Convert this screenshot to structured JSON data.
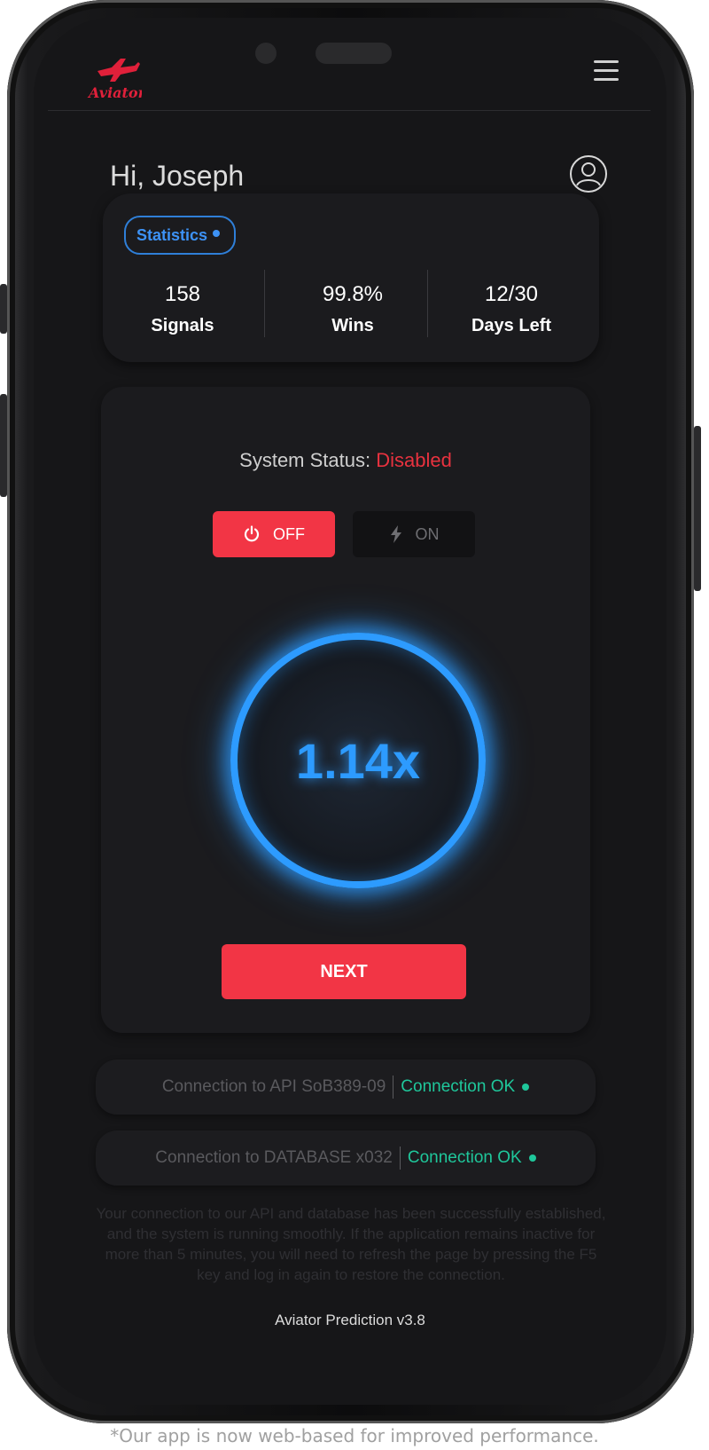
{
  "header": {
    "logo_text": "Aviator",
    "menu_icon": "hamburger-icon"
  },
  "greeting": "Hi, Joseph",
  "stats": {
    "badge_label": "Statistics",
    "items": [
      {
        "value": "158",
        "label": "Signals"
      },
      {
        "value": "99.8%",
        "label": "Wins"
      },
      {
        "value": "12/30",
        "label": "Days Left"
      }
    ]
  },
  "system": {
    "status_prefix": "System Status:",
    "status_value": "Disabled",
    "off_label": "OFF",
    "on_label": "ON",
    "multiplier": "1.14x",
    "next_label": "NEXT"
  },
  "connections": [
    {
      "target": "Connection to API SoB389-09",
      "status": "Connection OK"
    },
    {
      "target": "Connection to DATABASE x032",
      "status": "Connection OK"
    }
  ],
  "notice": "Your connection to our API and database has been successfully established, and the system is running smoothly. If the application remains inactive for more than 5 minutes, you will need to refresh the page by pressing the F5 key and log in again to restore the connection.",
  "version": "Aviator Prediction v3.8",
  "caption": "*Our app is now web-based for improved performance.",
  "colors": {
    "accent_red": "#f23545",
    "accent_blue": "#2d9bff",
    "ok_green": "#1fc79b",
    "background": "#161618"
  }
}
